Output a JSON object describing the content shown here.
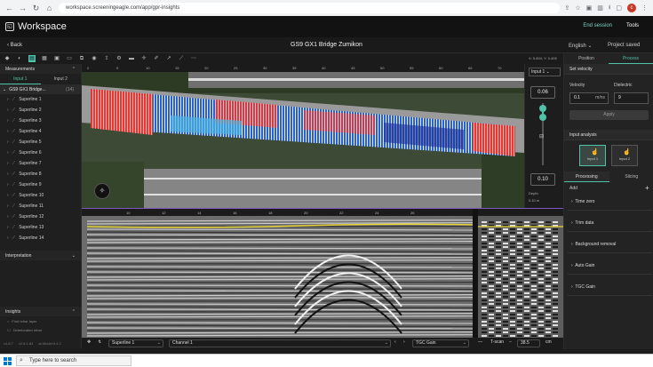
{
  "browser": {
    "url": "workspace.screeningeagle.com/app/gpr-insights",
    "profile_initial": "c"
  },
  "app": {
    "name": "Workspace",
    "end_session": "End session",
    "tools": "Tools",
    "back": "Back",
    "project_title": "GS9 GX1 Bridge Zumikon",
    "language": "English",
    "save_status": "Project saved",
    "coords": "X: 5.804, Y: 0.405"
  },
  "sidebar": {
    "measurements_title": "Measurements",
    "tabs": [
      "Input 1",
      "Input 2"
    ],
    "project": {
      "name": "GS9 GX1 Bridge...",
      "count": "(14)"
    },
    "superlines": [
      "Superline 1",
      "Superline 2",
      "Superline 3",
      "Superline 4",
      "Superline 5",
      "Superline 6",
      "Superline 7",
      "Superline 8",
      "Superline 9",
      "Superline 10",
      "Superline 11",
      "Superline 12",
      "Superline 13",
      "Superline 14"
    ],
    "interpretation_title": "Interpretation",
    "insights_title": "Insights",
    "insights_items": [
      "Find rebar layer",
      "Deteriorated rebar"
    ],
    "version": [
      "v4.8.7",
      "v2.8.1.84",
      "ai-Model:5.4.2"
    ]
  },
  "map": {
    "ruler_ticks": [
      "0",
      "5",
      "10",
      "15",
      "20",
      "25",
      "30",
      "35",
      "40",
      "45",
      "50",
      "55",
      "60",
      "65",
      "70"
    ]
  },
  "mapside": {
    "input_select": "Input 1",
    "top_value": "0.06",
    "bottom_value": "0.10",
    "depth_label": "Depth",
    "depth_value": "0.10 m"
  },
  "radar": {
    "ruler_ticks": [
      "10",
      "12",
      "14",
      "16",
      "18",
      "20",
      "22",
      "24",
      "26"
    ],
    "superline_select": "Superline 1",
    "channel_select": "Channel 1",
    "gain_select": "TGC Gain",
    "tscan_label": "T-scan",
    "tscan_value": "38.5",
    "tscan_unit": "cm"
  },
  "rpanel": {
    "tabs": [
      "Position",
      "Process"
    ],
    "set_velocity": "Set velocity",
    "velocity_label": "Velocity",
    "velocity_value": "0.1",
    "velocity_unit": "m/ns",
    "dielectric_label": "Dielectric",
    "dielectric_value": "9",
    "apply": "Apply",
    "input_analysis": "Input analysis",
    "inputs": [
      "Input 1",
      "Input 2"
    ],
    "proc_tabs": [
      "Processing",
      "Slicing"
    ],
    "add_label": "Add",
    "processing_steps": [
      "Time zero",
      "Trim data",
      "Background removal",
      "Auto Gain",
      "TGC Gain"
    ]
  },
  "taskbar": {
    "search_placeholder": "Type here to search"
  },
  "colors": {
    "accent": "#4fc3a7",
    "purple_border": "#7e57c2"
  }
}
